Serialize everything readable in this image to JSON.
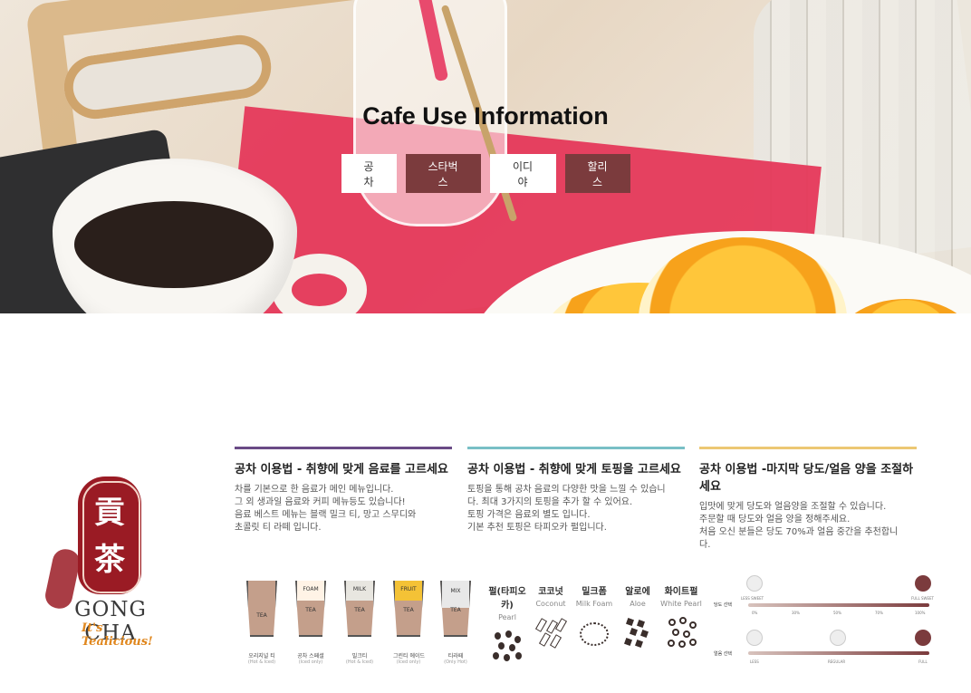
{
  "hero": {
    "title": "Cafe Use Information",
    "tabs": [
      {
        "label": "공차",
        "active": false
      },
      {
        "label": "스타벅스",
        "active": true
      },
      {
        "label": "이디야",
        "active": false
      },
      {
        "label": "할리스",
        "active": true
      }
    ]
  },
  "brand": {
    "char_top": "貢",
    "char_bottom": "茶",
    "name": "GONG CHA",
    "tagline": "It's Tealicious!"
  },
  "columns": [
    {
      "title": "공차 이용법 - 취향에 맞게 음료를 고르세요",
      "lines": [
        "차를 기본으로 한 음료가 메인 메뉴입니다.",
        "그 외 생과일 음료와 커피 메뉴등도 있습니다!",
        "음료 베스트 메뉴는 블랙 밀크 티, 망고 스무디와",
        "초콜릿 티 라떼 입니다."
      ]
    },
    {
      "title": "공차 이용법 - 취향에 맞게 토핑을 고르세요",
      "lines": [
        "토핑을 통해 공차 음료의 다양한 맛을 느낄 수 있습니",
        "다. 최대 3가지의 토핑을 추가 할 수 있어요.",
        "토핑 가격은 음료외 별도 입니다.",
        "기본 추천 토핑은 타피오카 펄입니다."
      ]
    },
    {
      "title": "공차 이용법 -마지막 당도/얼음 양을 조절하세요",
      "lines": [
        "입맛에 맞게 당도와 얼음양을 조절할 수 있습니다.",
        "주문할 때 당도와 얼음 양을 정해주세요.",
        "처음 오신 분들은 당도 70%과 얼음 중간을 추천합니",
        "다."
      ]
    }
  ],
  "drinks": [
    {
      "top": "",
      "bottom": "TEA",
      "name": "오리지널 티",
      "sub": "(Hot & Iced)"
    },
    {
      "top": "FOAM",
      "bottom": "TEA",
      "name": "공차 스페셜",
      "sub": "(Iced only)"
    },
    {
      "top": "MILK",
      "bottom": "TEA",
      "name": "밀크티",
      "sub": "(Hot & Iced)"
    },
    {
      "top": "FRUIT",
      "bottom": "TEA",
      "name": "그린티 에이드",
      "sub": "(Iced only)"
    },
    {
      "top": "MIX",
      "bottom": "TEA",
      "name": "티라떼",
      "sub": "(Only Hot)"
    }
  ],
  "toppings": [
    {
      "ko": "펄(타피오카)",
      "en": "Pearl"
    },
    {
      "ko": "코코넛",
      "en": "Coconut"
    },
    {
      "ko": "밀크폼",
      "en": "Milk Foam"
    },
    {
      "ko": "알로에",
      "en": "Aloe"
    },
    {
      "ko": "화이트펄",
      "en": "White Pearl"
    }
  ],
  "levels": {
    "sugar_label": "당도 선택",
    "sugar_low": "LESS SWEET",
    "sugar_high": "FULL SWEET",
    "sugar_ticks": [
      "0%",
      "30%",
      "50%",
      "70%",
      "100%"
    ],
    "ice_label": "얼음 선택",
    "ice_ticks": [
      "LESS",
      "REGULAR",
      "FULL"
    ]
  },
  "colors": {
    "accent": "#7b3b3d",
    "col1_bar": "#6a4b86",
    "col2_bar": "#79bfc6",
    "col3_bar": "#ecc873",
    "logo_red": "#9a1b24",
    "logo_orange": "#e0871e"
  }
}
